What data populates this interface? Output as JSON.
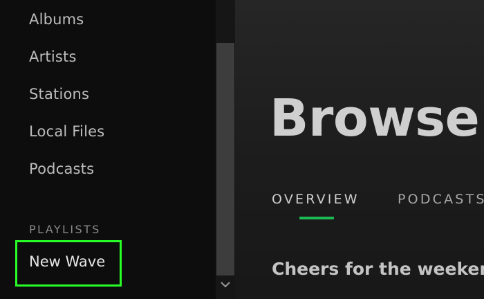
{
  "sidebar": {
    "nav_items": [
      "Albums",
      "Artists",
      "Stations",
      "Local Files",
      "Podcasts"
    ],
    "playlists_header": "PLAYLISTS",
    "playlists": [
      "New Wave"
    ],
    "highlight_color": "#27ff27"
  },
  "main": {
    "title": "Browse",
    "tabs": [
      {
        "label": "OVERVIEW",
        "active": true
      },
      {
        "label": "PODCASTS",
        "active": false
      }
    ],
    "accent_color": "#1db954",
    "section_heading": "Cheers for the weeken"
  },
  "icons": {
    "scroll_down": "chevron-down-icon"
  }
}
